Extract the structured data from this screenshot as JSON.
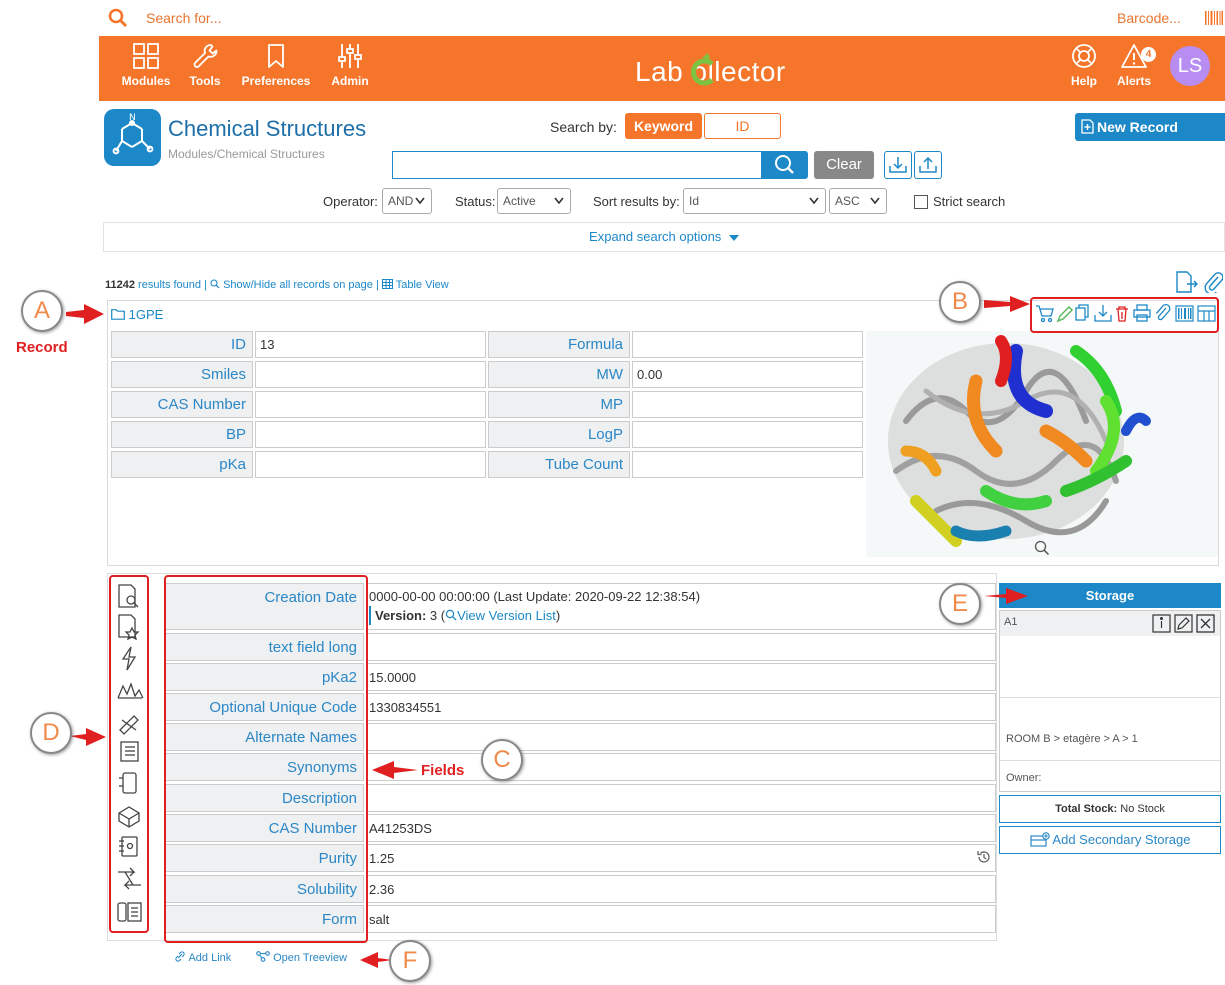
{
  "topbar": {
    "search_placeholder": "Search for...",
    "barcode_label": "Barcode..."
  },
  "nav": {
    "modules": "Modules",
    "tools": "Tools",
    "preferences": "Preferences",
    "admin": "Admin",
    "logo": "Lab  ollector",
    "help": "Help",
    "alerts": "Alerts",
    "alerts_count": "4",
    "avatar": "LS"
  },
  "module": {
    "title": "Chemical Structures",
    "path": "Modules/Chemical Structures"
  },
  "search": {
    "search_by_label": "Search by:",
    "keyword_label": "Keyword",
    "id_label": "ID",
    "clear_label": "Clear",
    "new_record_label": "New Record",
    "operator_label": "Operator:",
    "operator_value": "AND",
    "status_label": "Status:",
    "status_value": "Active",
    "sort_label": "Sort results by:",
    "sort_value": "Id",
    "sort_dir": "ASC",
    "strict_label": "Strict search",
    "expand_label": "Expand search options"
  },
  "results": {
    "count": "11242",
    "found_text": "results found |",
    "show_hide": "Show/Hide all records on page",
    "table_view": "Table View"
  },
  "record": {
    "name": "1GPE",
    "fields_left": [
      {
        "label": "ID",
        "value": "13"
      },
      {
        "label": "Smiles",
        "value": ""
      },
      {
        "label": "CAS Number",
        "value": ""
      },
      {
        "label": "BP",
        "value": ""
      },
      {
        "label": "pKa",
        "value": ""
      }
    ],
    "fields_right": [
      {
        "label": "Formula",
        "value": ""
      },
      {
        "label": "MW",
        "value": "0.00"
      },
      {
        "label": "MP",
        "value": ""
      },
      {
        "label": "LogP",
        "value": ""
      },
      {
        "label": "Tube Count",
        "value": ""
      }
    ]
  },
  "details": {
    "creation_label": "Creation Date",
    "creation_value": "0000-00-00 00:00:00 (Last Update: 2020-09-22 12:38:54)",
    "version_label": "Version:",
    "version_value": "3 (",
    "view_version_list": "View Version List",
    "version_close": ")",
    "fields": [
      {
        "label": "text field long",
        "value": ""
      },
      {
        "label": "pKa2",
        "value": "15.0000"
      },
      {
        "label": "Optional Unique Code",
        "value": "1330834551"
      },
      {
        "label": "Alternate Names",
        "value": ""
      },
      {
        "label": "Synonyms",
        "value": ""
      },
      {
        "label": "Description",
        "value": ""
      },
      {
        "label": "CAS Number",
        "value": "A41253DS"
      },
      {
        "label": "Purity",
        "value": "1.25"
      },
      {
        "label": "Solubility",
        "value": "2.36"
      },
      {
        "label": "Form",
        "value": "salt"
      }
    ]
  },
  "storage": {
    "header": "Storage",
    "slot": "A1",
    "location": "ROOM B > etagère > A > 1",
    "owner_label": "Owner:",
    "total_label": "Total Stock:",
    "total_value": "No Stock",
    "add_secondary": "Add Secondary Storage"
  },
  "links": {
    "add_link": "Add Link",
    "open_treeview": "Open Treeview"
  },
  "annotations": {
    "a": "A",
    "b": "B",
    "c": "C",
    "d": "D",
    "e": "E",
    "f": "F",
    "record_text": "Record",
    "fields_text": "Fields"
  },
  "colors": {
    "brand_orange": "#f5762a",
    "brand_blue": "#1c88c7",
    "annotation_red": "#e02020"
  }
}
